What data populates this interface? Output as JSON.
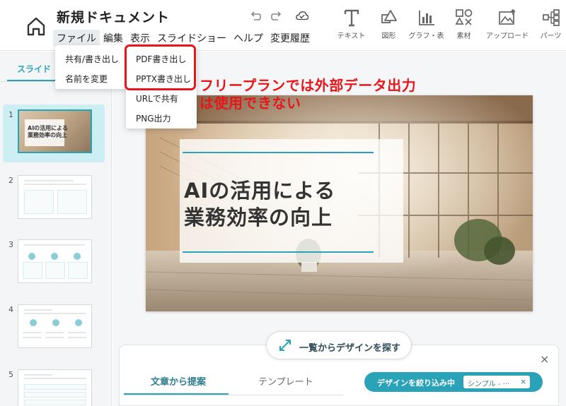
{
  "header": {
    "doc_title": "新規ドキュメント",
    "menu": [
      "ファイル",
      "編集",
      "表示",
      "スライドショー",
      "ヘルプ",
      "変更履歴"
    ],
    "tools": [
      {
        "icon": "text-icon",
        "label": "テキスト"
      },
      {
        "icon": "shape-icon",
        "label": "図形"
      },
      {
        "icon": "chart-icon",
        "label": "グラフ・表"
      },
      {
        "icon": "assets-icon",
        "label": "素材"
      },
      {
        "icon": "upload-icon",
        "label": "アップロード"
      },
      {
        "icon": "parts-icon",
        "label": "パーツ"
      }
    ]
  },
  "file_menu": {
    "items": [
      "共有/書き出し",
      "名前を変更"
    ],
    "submenu": [
      "PDF書き出し",
      "PPTX書き出し",
      "URLで共有",
      "PNG出力"
    ]
  },
  "annotation": {
    "line1": "フリープランでは外部データ出力",
    "line2": "は使用できない",
    "color": "#e8161b"
  },
  "left_panel": {
    "tab": "スライド",
    "slides": [
      {
        "num": "1",
        "text1": "AIの活用による",
        "text2": "業務効率の向上"
      },
      {
        "num": "2"
      },
      {
        "num": "3"
      },
      {
        "num": "4"
      },
      {
        "num": "5"
      }
    ]
  },
  "slide": {
    "title_line1": "AIの活用による",
    "title_line2": "業務効率の向上"
  },
  "bottom": {
    "find_design": "一覧からデザインを探す",
    "close": "×",
    "tab_suggest": "文章から提案",
    "tab_template": "テンプレート",
    "filter_label": "デザインを絞り込み中",
    "filter_chip": "シンプル - ···",
    "filter_chip_close": "×"
  },
  "colors": {
    "accent": "#2aa3b8",
    "highlight_red": "#e8161b"
  }
}
